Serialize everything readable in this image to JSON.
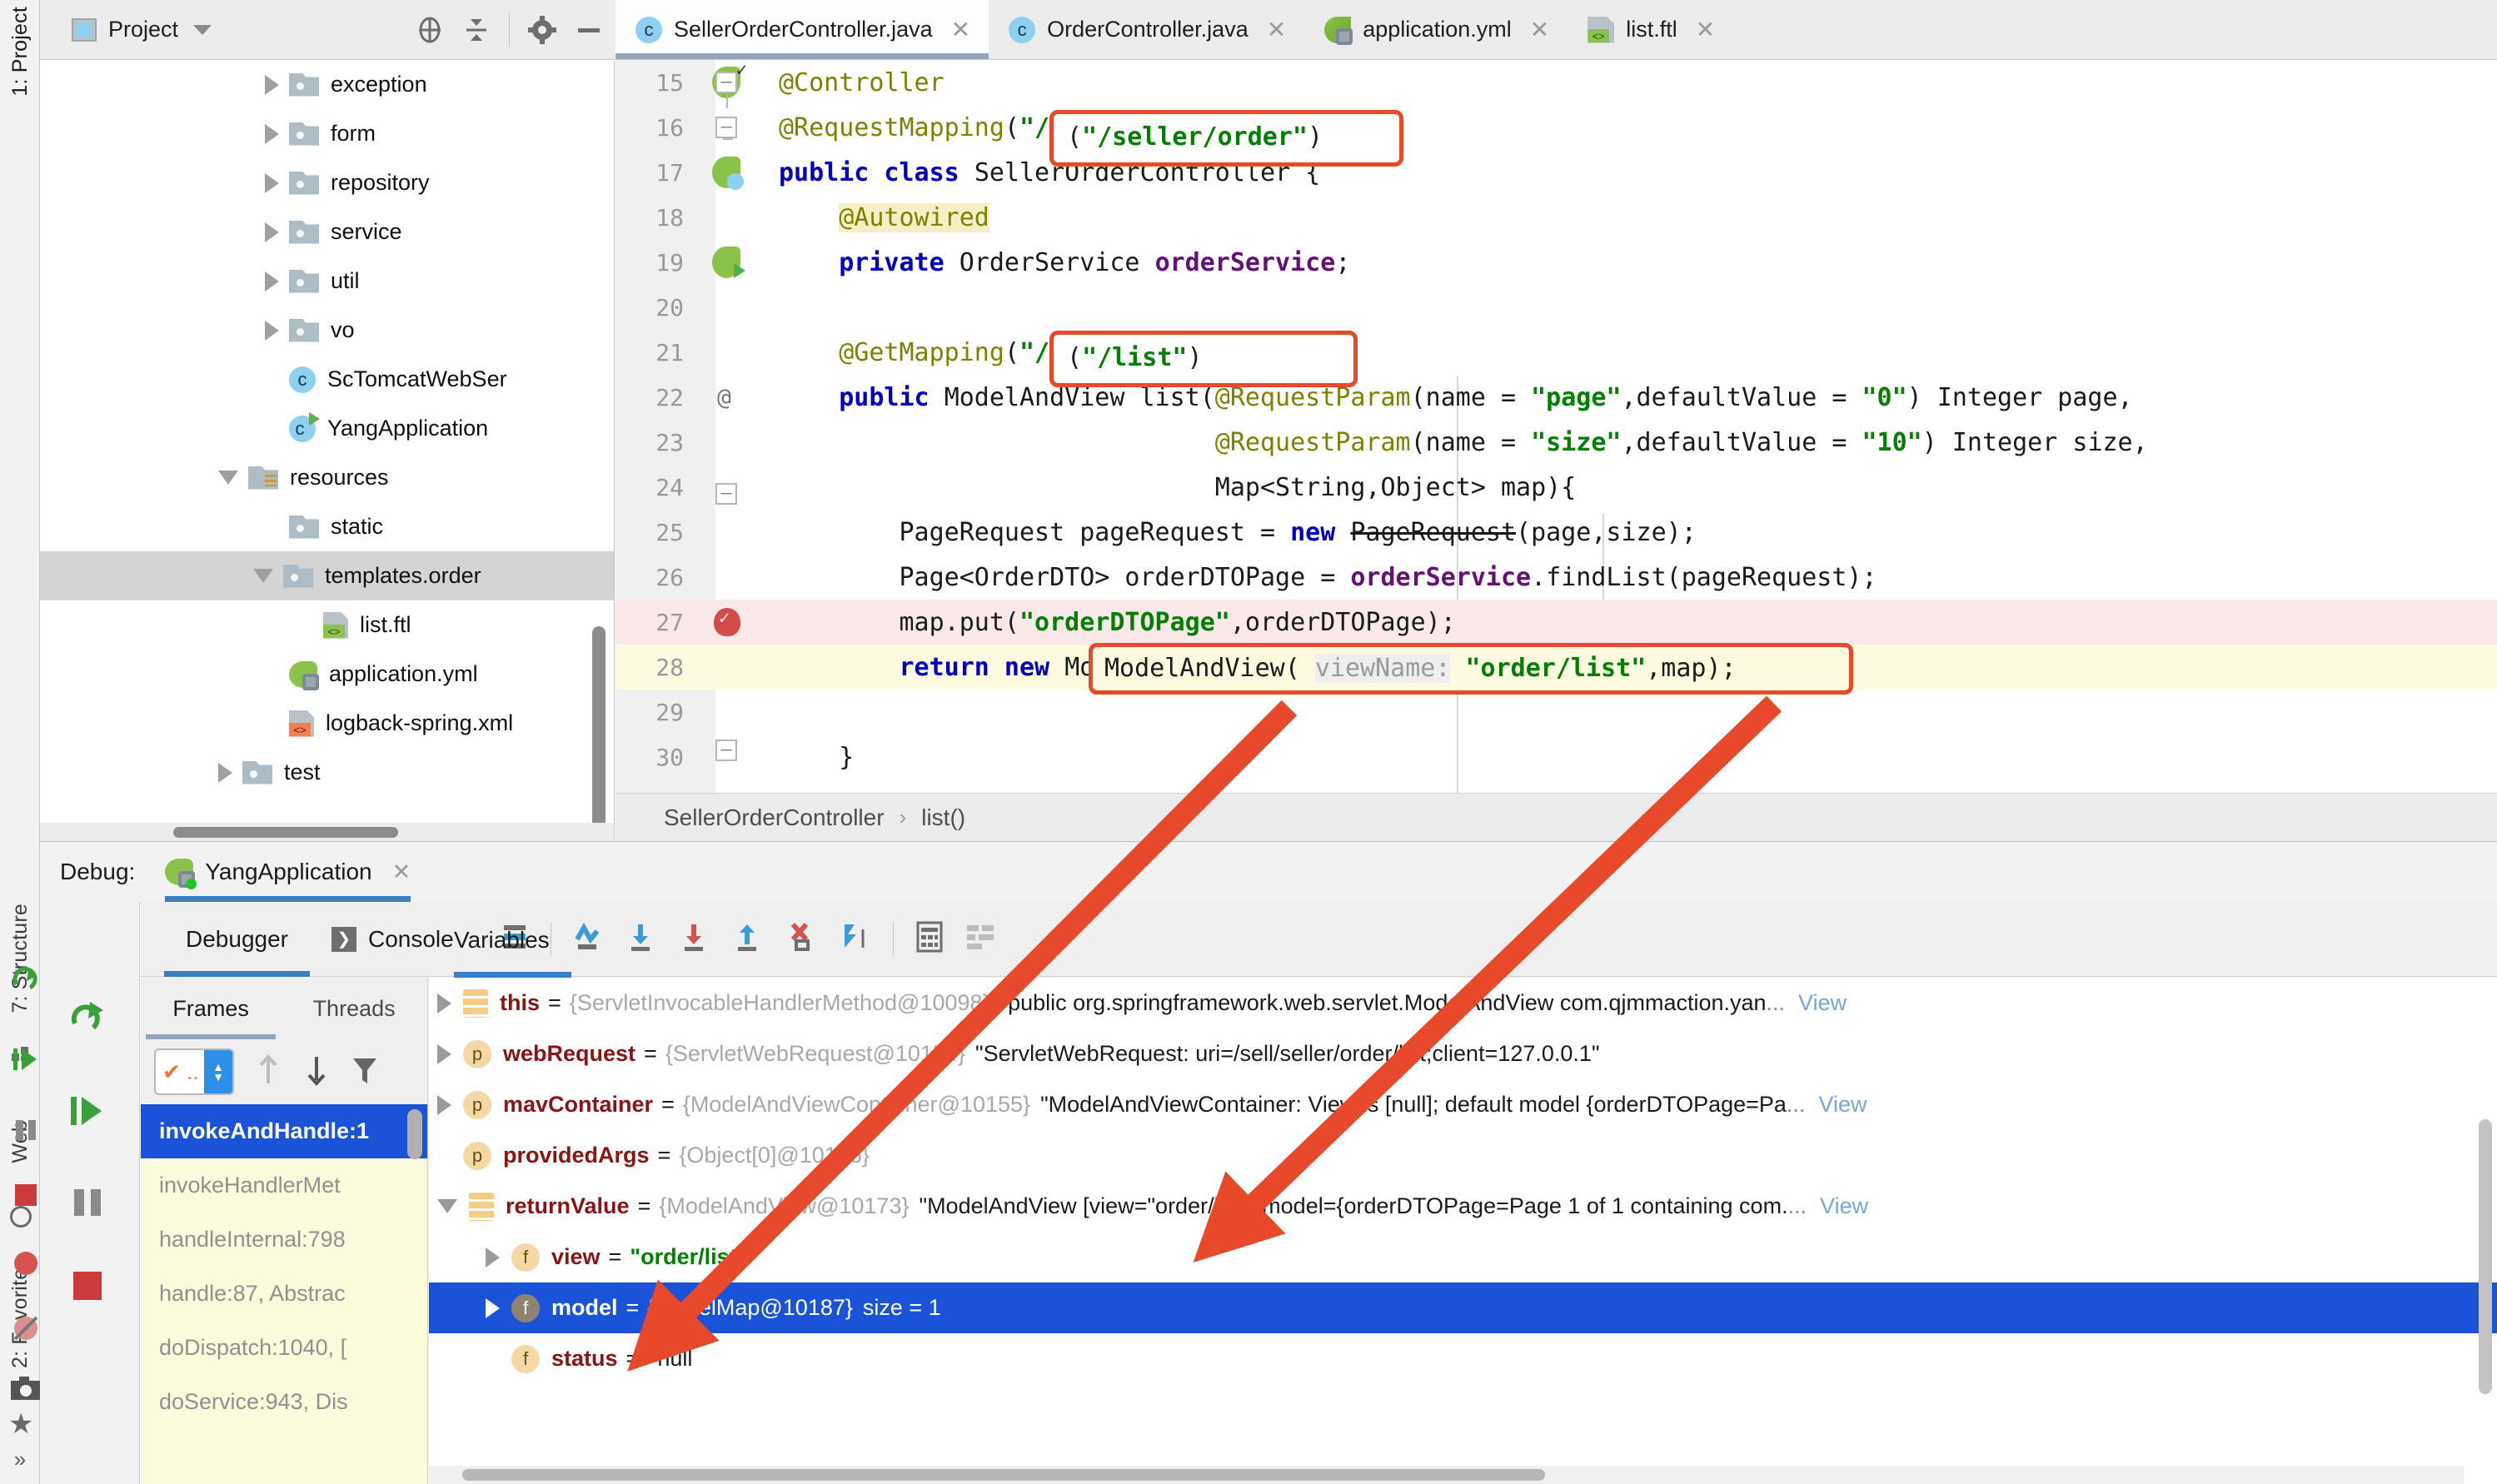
{
  "project_panel": {
    "title": "Project",
    "icons": [
      "locate-icon",
      "collapse-all-icon",
      "settings-gear-icon",
      "minimize-icon"
    ],
    "tree": [
      {
        "label": "exception",
        "type": "folder",
        "state": "collapsed",
        "indent": 3
      },
      {
        "label": "form",
        "type": "folder",
        "state": "collapsed",
        "indent": 3
      },
      {
        "label": "repository",
        "type": "folder",
        "state": "collapsed",
        "indent": 3
      },
      {
        "label": "service",
        "type": "folder",
        "state": "collapsed",
        "indent": 3
      },
      {
        "label": "util",
        "type": "folder",
        "state": "collapsed",
        "indent": 3
      },
      {
        "label": "vo",
        "type": "folder",
        "state": "collapsed",
        "indent": 3
      },
      {
        "label": "ScTomcatWebSer",
        "type": "class",
        "state": "leaf",
        "indent": 4
      },
      {
        "label": "YangApplication",
        "type": "spring-class",
        "state": "leaf",
        "indent": 4
      },
      {
        "label": "resources",
        "type": "resources-folder",
        "state": "expanded",
        "indent": 2
      },
      {
        "label": "static",
        "type": "folder",
        "state": "leaf",
        "indent": 3
      },
      {
        "label": "templates.order",
        "type": "folder",
        "state": "expanded",
        "indent": 3,
        "selected": true
      },
      {
        "label": "list.ftl",
        "type": "ftl",
        "state": "leaf",
        "indent": 4
      },
      {
        "label": "application.yml",
        "type": "yml",
        "state": "leaf",
        "indent": 3
      },
      {
        "label": "logback-spring.xml",
        "type": "xml",
        "state": "leaf",
        "indent": 3
      },
      {
        "label": "test",
        "type": "folder",
        "state": "leaf",
        "indent": 2
      }
    ]
  },
  "left_rail": [
    {
      "label": "1: Project",
      "icon": "project-icon"
    },
    {
      "label": "7: Structure",
      "icon": "structure-icon"
    },
    {
      "label": "Web",
      "icon": "globe-icon"
    },
    {
      "label": "2: Favorites",
      "icon": "star-icon"
    }
  ],
  "left_rail_debug_icons": [
    "debug-run-icon",
    "resume-icon",
    "pause-icon",
    "stop-icon",
    "mute-breakpoints-icon",
    "camera-icon"
  ],
  "editor_tabs": [
    {
      "label": "SellerOrderController.java",
      "icon": "java-class-icon",
      "active": true
    },
    {
      "label": "OrderController.java",
      "icon": "java-class-icon",
      "active": false
    },
    {
      "label": "application.yml",
      "icon": "spring-yml-icon",
      "active": false
    },
    {
      "label": "list.ftl",
      "icon": "ftl-file-icon",
      "active": false
    }
  ],
  "editor": {
    "breadcrumb": [
      "SellerOrderController",
      "list()"
    ],
    "breadcrumb_separator": "›",
    "lines": [
      {
        "num": "15",
        "code": "@Controller"
      },
      {
        "num": "16",
        "code": "@RequestMapping(\"/seller/order\")"
      },
      {
        "num": "17",
        "code": "public class SellerOrderController {"
      },
      {
        "num": "18",
        "code": "    @Autowired"
      },
      {
        "num": "19",
        "code": "    private OrderService orderService;"
      },
      {
        "num": "20",
        "code": ""
      },
      {
        "num": "21",
        "code": "    @GetMapping(\"/list\")"
      },
      {
        "num": "22",
        "code": "    public ModelAndView list(@RequestParam(name = \"page\",defaultValue = \"0\") Integer page,"
      },
      {
        "num": "23",
        "code": "                             @RequestParam(name = \"size\",defaultValue = \"10\") Integer size,"
      },
      {
        "num": "24",
        "code": "                             Map<String,Object> map){"
      },
      {
        "num": "25",
        "code": "        PageRequest pageRequest = new PageRequest(page,size);"
      },
      {
        "num": "26",
        "code": "        Page<OrderDTO> orderDTOPage = orderService.findList(pageRequest);"
      },
      {
        "num": "27",
        "code": "        map.put(\"orderDTOPage\",orderDTOPage);"
      },
      {
        "num": "28",
        "code": "        return new ModelAndView( viewName: \"order/list\",map);"
      },
      {
        "num": "29",
        "code": ""
      },
      {
        "num": "30",
        "code": "    }"
      }
    ],
    "inlay_hint": "viewName:",
    "highlight_boxes": [
      {
        "name": "request-mapping-path",
        "text": "(\"/seller/order\")"
      },
      {
        "name": "get-mapping-path",
        "text": "(\"/list\")"
      },
      {
        "name": "model-and-view-call",
        "text": "ModelAndView( viewName: \"order/list\",map);"
      }
    ]
  },
  "debug": {
    "header_label": "Debug:",
    "run_config": "YangApplication",
    "close_label": "✕",
    "tabs": [
      {
        "label": "Debugger",
        "active": true
      },
      {
        "label": "Console",
        "active": false
      }
    ],
    "toolbar_icons": [
      "layout-icon",
      "step-over-icon",
      "step-into-icon",
      "force-step-into-icon",
      "step-out-icon",
      "drop-frame-icon",
      "run-to-cursor-icon",
      "evaluate-expression-icon",
      "settings-icon"
    ],
    "side_icons": [
      "rerun-icon",
      "resume-program-icon",
      "pause-icon",
      "stop-icon",
      "mute-breakpoints-icon"
    ],
    "sub_tabs": [
      {
        "label": "Frames",
        "active": true
      },
      {
        "label": "Threads",
        "active": false
      },
      {
        "label": "Variables",
        "active": true
      }
    ],
    "frames_toolbar_icons": [
      "thread-selector",
      "up-arrow-icon",
      "down-arrow-icon",
      "filter-icon"
    ],
    "frames": [
      {
        "label": "invokeAndHandle:1",
        "selected": true
      },
      {
        "label": "invokeHandlerMet",
        "selected": false
      },
      {
        "label": "handleInternal:798",
        "selected": false
      },
      {
        "label": "handle:87, Abstrac",
        "selected": false
      },
      {
        "label": "doDispatch:1040, [",
        "selected": false
      },
      {
        "label": "doService:943, Dis",
        "selected": false
      }
    ],
    "variables": [
      {
        "expand": "collapsed",
        "badge": "obj",
        "name": "this",
        "eq": "=",
        "type": "{ServletInvocableHandlerMethod@10098}",
        "value": "\"public org.springframework.web.servlet.ModelAndView com.qjmmaction.yan",
        "ellipsis": "...",
        "view": "View",
        "indent": 0,
        "selected": false
      },
      {
        "expand": "collapsed",
        "badge": "p",
        "name": "webRequest",
        "eq": "=",
        "type": "{ServletWebRequest@10154}",
        "value": "\"ServletWebRequest: uri=/sell/seller/order/list;client=127.0.0.1\"",
        "ellipsis": "",
        "view": "",
        "indent": 0,
        "selected": false
      },
      {
        "expand": "collapsed",
        "badge": "p",
        "name": "mavContainer",
        "eq": "=",
        "type": "{ModelAndViewContainer@10155}",
        "value": "\"ModelAndViewContainer: View is [null]; default model {orderDTOPage=Pa",
        "ellipsis": "...",
        "view": "View",
        "indent": 0,
        "selected": false
      },
      {
        "expand": "none",
        "badge": "p",
        "name": "providedArgs",
        "eq": "=",
        "type": "{Object[0]@10156}",
        "value": "",
        "ellipsis": "",
        "view": "",
        "indent": 0,
        "selected": false
      },
      {
        "expand": "expanded",
        "badge": "obj",
        "name": "returnValue",
        "eq": "=",
        "type": "{ModelAndView@10173}",
        "value": "\"ModelAndView [view=\"order/list\"; model={orderDTOPage=Page 1 of 1 containing com.",
        "ellipsis": "...",
        "view": "View",
        "indent": 0,
        "selected": false
      },
      {
        "expand": "collapsed",
        "badge": "f",
        "name": "view",
        "eq": "=",
        "type": "",
        "value_str": "\"order/list\"",
        "ellipsis": "",
        "view": "",
        "indent": 1,
        "selected": false
      },
      {
        "expand": "collapsed",
        "badge": "f-gray",
        "name": "model",
        "eq": "=",
        "type": "{ModelMap@10187}",
        "value": "size = 1",
        "ellipsis": "",
        "view": "",
        "indent": 1,
        "selected": true
      },
      {
        "expand": "none",
        "badge": "f",
        "name": "status",
        "eq": "=",
        "type": "",
        "value": "null",
        "ellipsis": "",
        "view": "",
        "indent": 1,
        "selected": false
      }
    ]
  },
  "colors": {
    "annotation_red": "#e8492a",
    "selection_blue": "#1a53d8",
    "tab_underline": "#3c7fc1",
    "string_green": "#008000",
    "keyword_blue": "#0000c0",
    "annotation_olive": "#808000",
    "field_purple": "#660e7a"
  }
}
